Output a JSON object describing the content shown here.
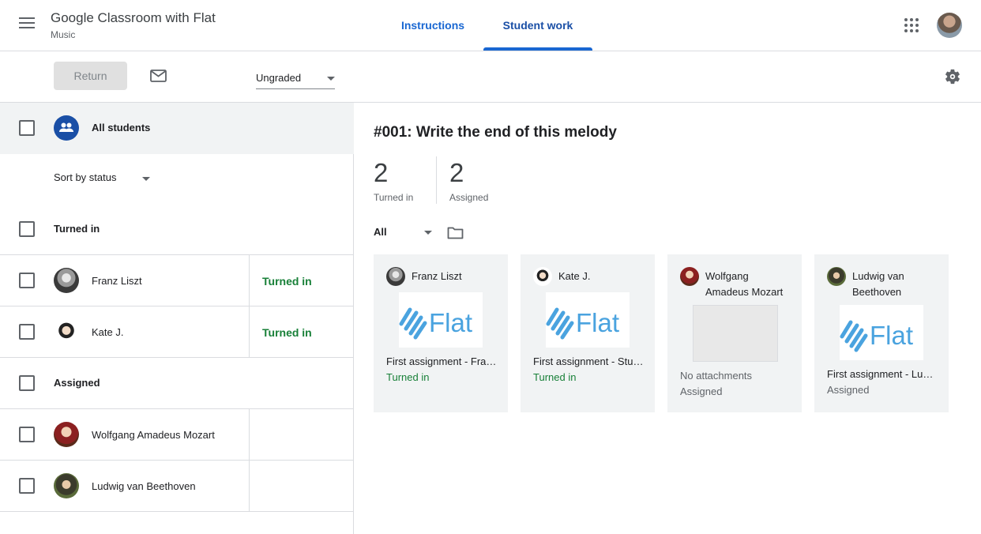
{
  "header": {
    "class_title": "Google Classroom with Flat",
    "class_subtitle": "Music",
    "tabs": [
      {
        "label": "Instructions",
        "active": false
      },
      {
        "label": "Student work",
        "active": true
      }
    ]
  },
  "toolbar": {
    "return_label": "Return",
    "grade_filter": "Ungraded"
  },
  "roster": {
    "all_students_label": "All students",
    "sort_label": "Sort by status",
    "groups": [
      {
        "label": "Turned in",
        "students": [
          {
            "name": "Franz Liszt",
            "status": "Turned in"
          },
          {
            "name": "Kate J.",
            "status": "Turned in"
          }
        ]
      },
      {
        "label": "Assigned",
        "students": [
          {
            "name": "Wolfgang Amadeus Mozart",
            "status": ""
          },
          {
            "name": "Ludwig van Beethoven",
            "status": ""
          }
        ]
      }
    ]
  },
  "assignment": {
    "title": "#001: Write the end of this melody",
    "stats": [
      {
        "value": "2",
        "label": "Turned in"
      },
      {
        "value": "2",
        "label": "Assigned"
      }
    ],
    "filter": "All"
  },
  "cards": [
    {
      "name": "Franz Liszt",
      "file": "First assignment - Franz Liszt",
      "status": "Turned in",
      "logo_text": "Flat"
    },
    {
      "name": "Kate J.",
      "file": "First assignment - Student",
      "status": "Turned in",
      "logo_text": "Flat"
    },
    {
      "name": "Wolfgang Amadeus Mozart",
      "file": "No attachments",
      "status": "Assigned",
      "logo_text": ""
    },
    {
      "name": "Ludwig van Beethoven",
      "file": "First assignment - Ludwig van Beethoven",
      "status": "Assigned",
      "logo_text": "Flat"
    }
  ],
  "colors": {
    "accent": "#1967d2",
    "turned_in": "#188038",
    "flat_logo": "#4aa3df"
  }
}
